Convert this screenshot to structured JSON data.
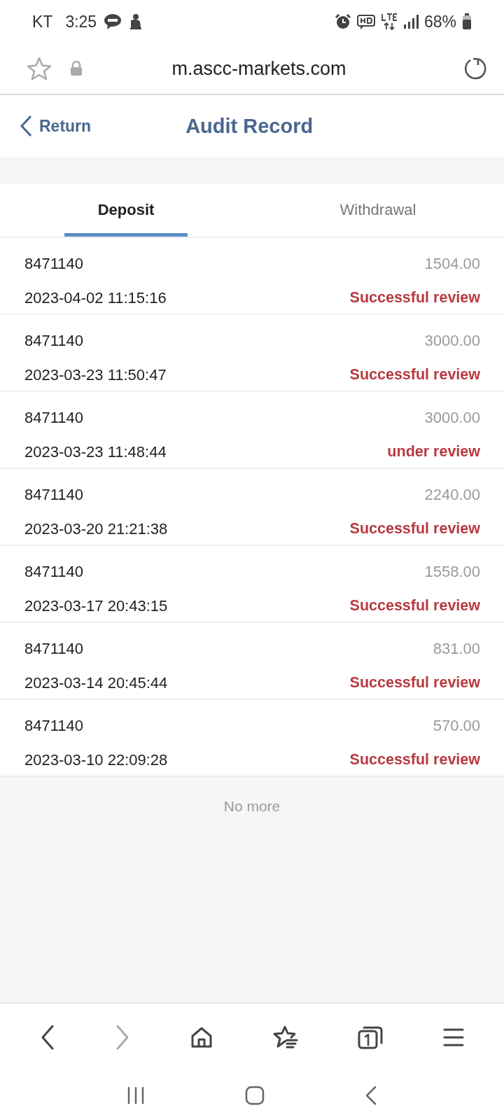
{
  "status_bar": {
    "carrier": "KT",
    "time": "3:25",
    "battery": "68%"
  },
  "browser": {
    "url": "m.ascc-markets.com"
  },
  "header": {
    "back": "Return",
    "title": "Audit Record"
  },
  "tabs": [
    {
      "label": "Deposit",
      "selected": true
    },
    {
      "label": "Withdrawal",
      "selected": false
    }
  ],
  "records": [
    {
      "account": "8471140",
      "amount": "1504.00",
      "time": "2023-04-02 11:15:16",
      "status": "Successful review"
    },
    {
      "account": "8471140",
      "amount": "3000.00",
      "time": "2023-03-23 11:50:47",
      "status": "Successful review"
    },
    {
      "account": "8471140",
      "amount": "3000.00",
      "time": "2023-03-23 11:48:44",
      "status": "under review"
    },
    {
      "account": "8471140",
      "amount": "2240.00",
      "time": "2023-03-20 21:21:38",
      "status": "Successful review"
    },
    {
      "account": "8471140",
      "amount": "1558.00",
      "time": "2023-03-17 20:43:15",
      "status": "Successful review"
    },
    {
      "account": "8471140",
      "amount": "831.00",
      "time": "2023-03-14 20:45:44",
      "status": "Successful review"
    },
    {
      "account": "8471140",
      "amount": "570.00",
      "time": "2023-03-10 22:09:28",
      "status": "Successful review"
    }
  ],
  "footer": "No more"
}
